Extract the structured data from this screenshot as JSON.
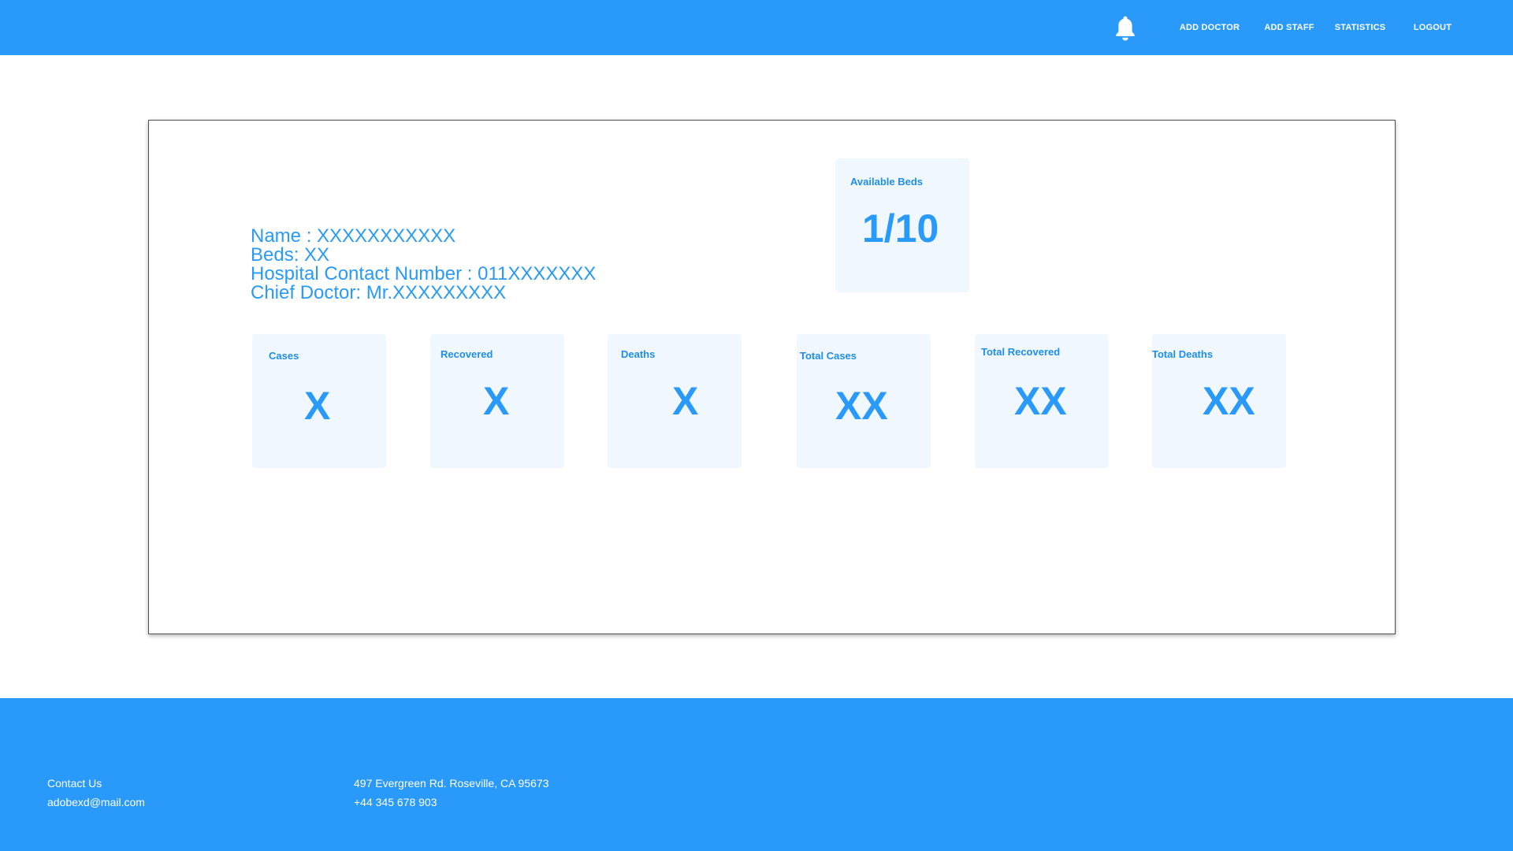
{
  "nav": {
    "bell_icon": "bell-icon",
    "add_doctor": "ADD DOCTOR",
    "add_staff": "ADD STAFF",
    "statistics": "STATISTICS",
    "logout": "LOGOUT"
  },
  "hospital": {
    "name": "Name : XXXXXXXXXXX",
    "beds": "Beds: XX",
    "contact": "Hospital Contact Number : 011XXXXXXX",
    "chief_doctor": "Chief Doctor: Mr.XXXXXXXXX"
  },
  "available_beds": {
    "label": "Available Beds",
    "value": "1/10"
  },
  "stats": [
    {
      "label": "Cases",
      "value": "X"
    },
    {
      "label": "Recovered",
      "value": "X"
    },
    {
      "label": "Deaths",
      "value": "X"
    },
    {
      "label": "Total Cases",
      "value": "XX"
    },
    {
      "label": "Total Recovered",
      "value": "XX"
    },
    {
      "label": "Total Deaths",
      "value": "XX"
    }
  ],
  "footer": {
    "contact_us": "Contact Us",
    "email": "adobexd@mail.com",
    "address": "497 Evergreen Rd. Roseville, CA 95673",
    "phone": "+44 345 678 903"
  },
  "colors": {
    "primary": "#2999fa",
    "card_background": "#f0f7fe"
  }
}
